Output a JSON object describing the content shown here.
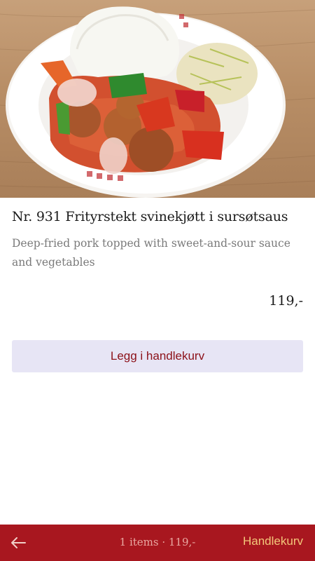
{
  "product": {
    "image_alt": "Sweet and sour pork with rice",
    "title": "Nr. 931 Frityrstekt svinekjøtt i sursøtsaus",
    "description": "Deep-fried pork topped with sweet-and-sour sauce and vegetables",
    "price": "119,-"
  },
  "actions": {
    "add_to_cart_label": "Legg i handlekurv"
  },
  "bottom_bar": {
    "back_icon": "arrow-left-icon",
    "cart_summary": "1 items · 119,-",
    "cart_label": "Handlekurv"
  },
  "colors": {
    "brand_red": "#a8171f",
    "button_bg": "#e7e5f5",
    "button_text": "#8c1119",
    "cart_label": "#f3c77a"
  }
}
